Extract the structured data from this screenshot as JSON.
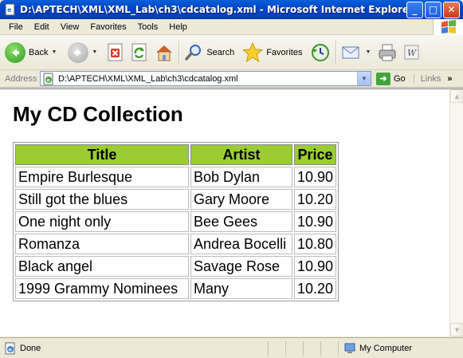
{
  "window": {
    "title": "D:\\APTECH\\XML\\XML_Lab\\ch3\\cdcatalog.xml - Microsoft Internet Explorer"
  },
  "menu": {
    "items": [
      "File",
      "Edit",
      "View",
      "Favorites",
      "Tools",
      "Help"
    ]
  },
  "toolbar": {
    "back_label": "Back",
    "search_label": "Search",
    "favorites_label": "Favorites"
  },
  "address": {
    "label": "Address",
    "value": "D:\\APTECH\\XML\\XML_Lab\\ch3\\cdcatalog.xml",
    "go_label": "Go",
    "links_label": "Links"
  },
  "page": {
    "heading": "My CD Collection",
    "columns": [
      "Title",
      "Artist",
      "Price"
    ],
    "rows": [
      [
        "Empire Burlesque",
        "Bob Dylan",
        "10.90"
      ],
      [
        "Still got the blues",
        "Gary Moore",
        "10.20"
      ],
      [
        "One night only",
        "Bee Gees",
        "10.90"
      ],
      [
        "Romanza",
        "Andrea Bocelli",
        "10.80"
      ],
      [
        "Black angel",
        "Savage Rose",
        "10.90"
      ],
      [
        "1999 Grammy Nominees",
        "Many",
        "10.20"
      ]
    ],
    "header_color": "#9acd32"
  },
  "status": {
    "text": "Done",
    "zone": "My Computer"
  },
  "icons": [
    "ie-page-icon",
    "back-icon",
    "forward-icon",
    "stop-icon",
    "refresh-icon",
    "home-icon",
    "search-icon",
    "favorites-star-icon",
    "history-icon",
    "mail-icon",
    "print-icon",
    "word-icon",
    "go-icon",
    "windows-logo-icon",
    "my-computer-icon"
  ]
}
